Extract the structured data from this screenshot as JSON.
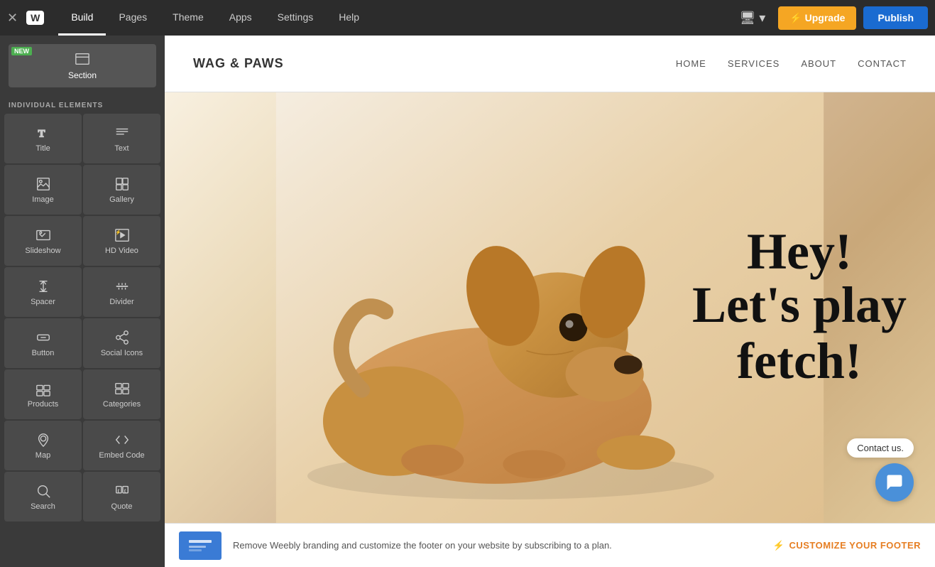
{
  "topbar": {
    "close_label": "✕",
    "logo": "W",
    "nav_items": [
      {
        "label": "Build",
        "active": true
      },
      {
        "label": "Pages",
        "active": false
      },
      {
        "label": "Theme",
        "active": false
      },
      {
        "label": "Apps",
        "active": false
      },
      {
        "label": "Settings",
        "active": false
      },
      {
        "label": "Help",
        "active": false
      }
    ],
    "device_label": "🖥 ▾",
    "upgrade_label": "⚡ Upgrade",
    "publish_label": "Publish"
  },
  "sidebar": {
    "section_label": "Section",
    "new_badge": "NEW",
    "elements_heading": "INDIVIDUAL ELEMENTS",
    "items": [
      {
        "label": "Title",
        "icon_type": "title"
      },
      {
        "label": "Text",
        "icon_type": "text"
      },
      {
        "label": "Image",
        "icon_type": "image"
      },
      {
        "label": "Gallery",
        "icon_type": "gallery"
      },
      {
        "label": "Slideshow",
        "icon_type": "slideshow"
      },
      {
        "label": "HD Video",
        "icon_type": "hdvideo"
      },
      {
        "label": "Spacer",
        "icon_type": "spacer"
      },
      {
        "label": "Divider",
        "icon_type": "divider"
      },
      {
        "label": "Button",
        "icon_type": "button"
      },
      {
        "label": "Social Icons",
        "icon_type": "social"
      },
      {
        "label": "Products",
        "icon_type": "products"
      },
      {
        "label": "Categories",
        "icon_type": "categories"
      },
      {
        "label": "Map",
        "icon_type": "map"
      },
      {
        "label": "Embed Code",
        "icon_type": "embed"
      },
      {
        "label": "Search",
        "icon_type": "search"
      },
      {
        "label": "Quote",
        "icon_type": "quote"
      }
    ]
  },
  "site": {
    "logo": "WAG & PAWS",
    "nav": [
      "HOME",
      "SERVICES",
      "ABOUT",
      "CONTACT"
    ],
    "hero_line1": "Hey!",
    "hero_line2": "Let's play fetch!",
    "contact_label": "Contact us."
  },
  "footer_banner": {
    "text": "Remove Weebly branding and customize the footer on your website by subscribing to a plan.",
    "cta": "CUSTOMIZE YOUR FOOTER",
    "lightning": "⚡"
  }
}
